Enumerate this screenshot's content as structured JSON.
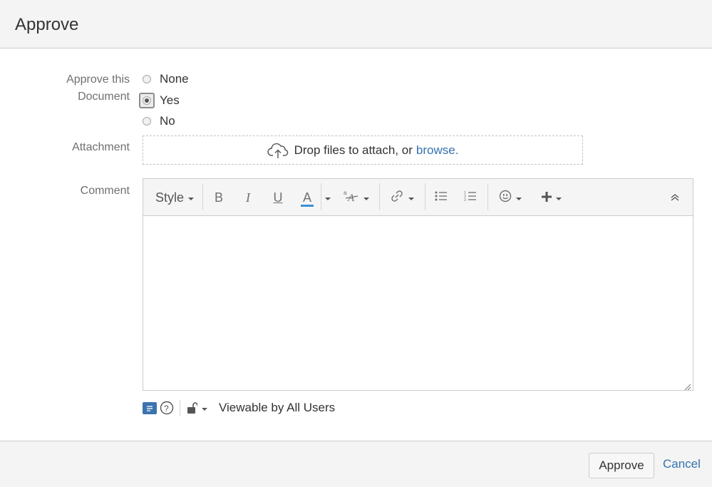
{
  "dialog": {
    "title": "Approve"
  },
  "form": {
    "approve_label_line1": "Approve this",
    "approve_label_line2": "Document",
    "options": [
      {
        "label": "None",
        "selected": false
      },
      {
        "label": "Yes",
        "selected": true
      },
      {
        "label": "No",
        "selected": false
      }
    ],
    "attachment_label": "Attachment",
    "comment_label": "Comment"
  },
  "attachment": {
    "prompt": "Drop files to attach, or ",
    "browse_link": "browse."
  },
  "toolbar": {
    "style_label": "Style",
    "bold_label": "B",
    "italic_label": "I",
    "underline_label": "U",
    "text_color_label": "A",
    "text_color_accent": "#3b8fd8"
  },
  "status": {
    "visibility": "Viewable by All Users"
  },
  "footer": {
    "approve_button": "Approve",
    "cancel_link": "Cancel"
  },
  "colors": {
    "link": "#3572b0",
    "header_bg": "#f4f4f4",
    "label": "#707070"
  }
}
